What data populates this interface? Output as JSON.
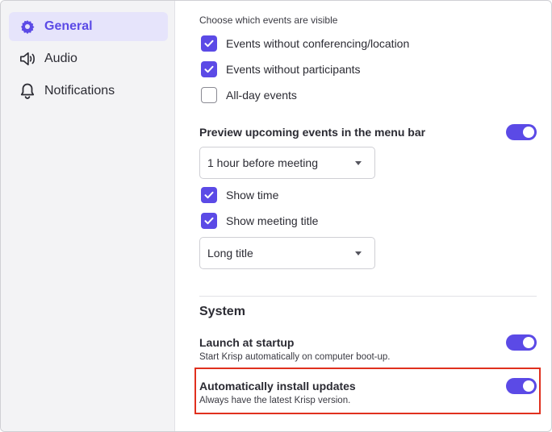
{
  "sidebar": {
    "items": [
      {
        "label": "General",
        "icon": "gear-icon",
        "active": true
      },
      {
        "label": "Audio",
        "icon": "speaker-icon",
        "active": false
      },
      {
        "label": "Notifications",
        "icon": "bell-icon",
        "active": false
      }
    ]
  },
  "events": {
    "heading": "Choose which events are visible",
    "options": [
      {
        "label": "Events without conferencing/location",
        "checked": true
      },
      {
        "label": "Events without participants",
        "checked": true
      },
      {
        "label": "All-day events",
        "checked": false
      }
    ]
  },
  "preview": {
    "title": "Preview upcoming events in the menu bar",
    "enabled": true,
    "timing_select": "1 hour before meeting",
    "show_time_label": "Show time",
    "show_time_checked": true,
    "show_title_label": "Show meeting title",
    "show_title_checked": true,
    "title_select": "Long title"
  },
  "system": {
    "heading": "System",
    "launch_title": "Launch at startup",
    "launch_desc": "Start Krisp automatically on computer boot-up.",
    "launch_enabled": true,
    "updates_title": "Automatically install updates",
    "updates_desc": "Always have the latest Krisp version.",
    "updates_enabled": true
  },
  "colors": {
    "accent": "#5b4ae6",
    "active_bg": "#e6e4fb",
    "highlight": "#e0301e"
  }
}
